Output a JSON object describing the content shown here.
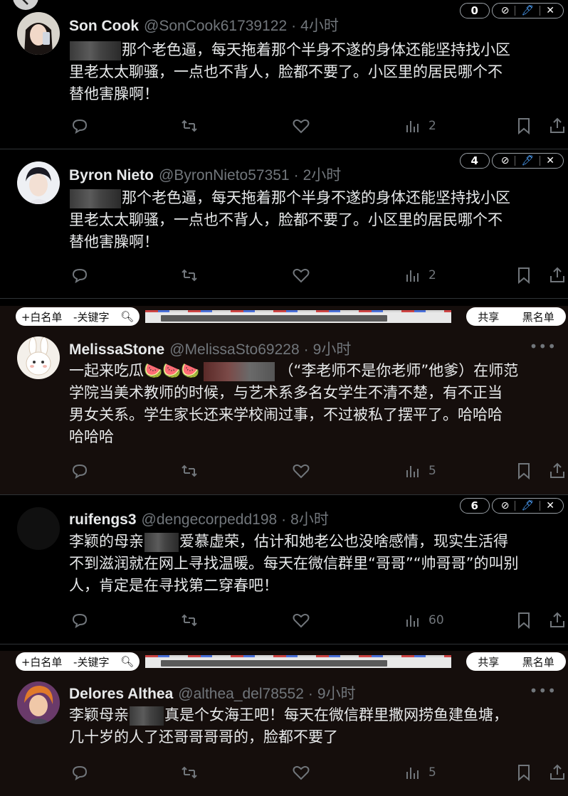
{
  "tweets": [
    {
      "name": "Son Cook",
      "handle": "@SonCook61739122",
      "time": "4小时",
      "badge_count": "0",
      "text_after_blur": "那个老色逼，每天拖着那个半身不遂的身体还能坚持找小区",
      "text_line2": "里老太太聊骚，一点也不背人，脸都不要了。小区里的居民哪个不",
      "text_line3": "替他害臊啊！",
      "views": "2"
    },
    {
      "name": "Byron Nieto",
      "handle": "@ByronNieto57351",
      "time": "2小时",
      "badge_count": "4",
      "text_after_blur": "那个老色逼，每天拖着那个半身不遂的身体还能坚持找小区",
      "text_line2": "里老太太聊骚，一点也不背人，脸都不要了。小区里的居民哪个不",
      "text_line3": "替他害臊啊！",
      "views": "2"
    },
    {
      "name": "MelissaStone",
      "handle": "@MelissaSto69228",
      "time": "9小时",
      "text_before_blur": "一起来吃瓜🍉🍉🍉",
      "text_after_blur": "（“李老师不是你老师”他爹）在师范",
      "text_line2": "学院当美术教师的时候，与艺术系多名女学生不清不楚，有不正当",
      "text_line3": "男女关系。学生家长还来学校闹过事，不过被私了摆平了。哈哈哈",
      "text_line4": "哈哈哈",
      "views": "5"
    },
    {
      "name": "ruifengs3",
      "handle": "@dengecorpedd198",
      "time": "8小时",
      "badge_count": "6",
      "text_before_blur": "李颖的母亲",
      "text_after_blur": "爱慕虚荣，估计和她老公也没啥感情，现实生活得",
      "text_line2": "不到滋润就在网上寻找温暖。每天在微信群里“哥哥”“帅哥哥”的叫别",
      "text_line3": "人，肯定是在寻找第二穿春吧！",
      "views": "60"
    },
    {
      "name": "Delores Althea",
      "handle": "@althea_del78552",
      "time": "9小时",
      "text_before_blur": "李颖母亲",
      "text_after_blur": "真是个女海王吧！每天在微信群里撒网捞鱼建鱼塘，",
      "text_line2": "几十岁的人了还哥哥哥哥的，脸都不要了",
      "views": "5"
    }
  ],
  "dot_separator": "·",
  "more_icon": "•••",
  "ext_toolbar": {
    "whitelist": "+白名单",
    "keyword": "-关键字",
    "share": "共享",
    "blacklist": "黑名单"
  },
  "badge_tools": {
    "block": "⊘",
    "edit": "🖊",
    "close": "✕"
  },
  "icons": {
    "reply": "reply-icon",
    "retweet": "retweet-icon",
    "like": "like-icon",
    "views": "views-icon",
    "bookmark": "bookmark-icon",
    "share": "share-icon",
    "search": "search-icon"
  },
  "colors": {
    "background": "#000000",
    "brown_background": "#150e0c",
    "text": "#e7e9ea",
    "muted": "#71767b",
    "divider": "#2f3336"
  }
}
